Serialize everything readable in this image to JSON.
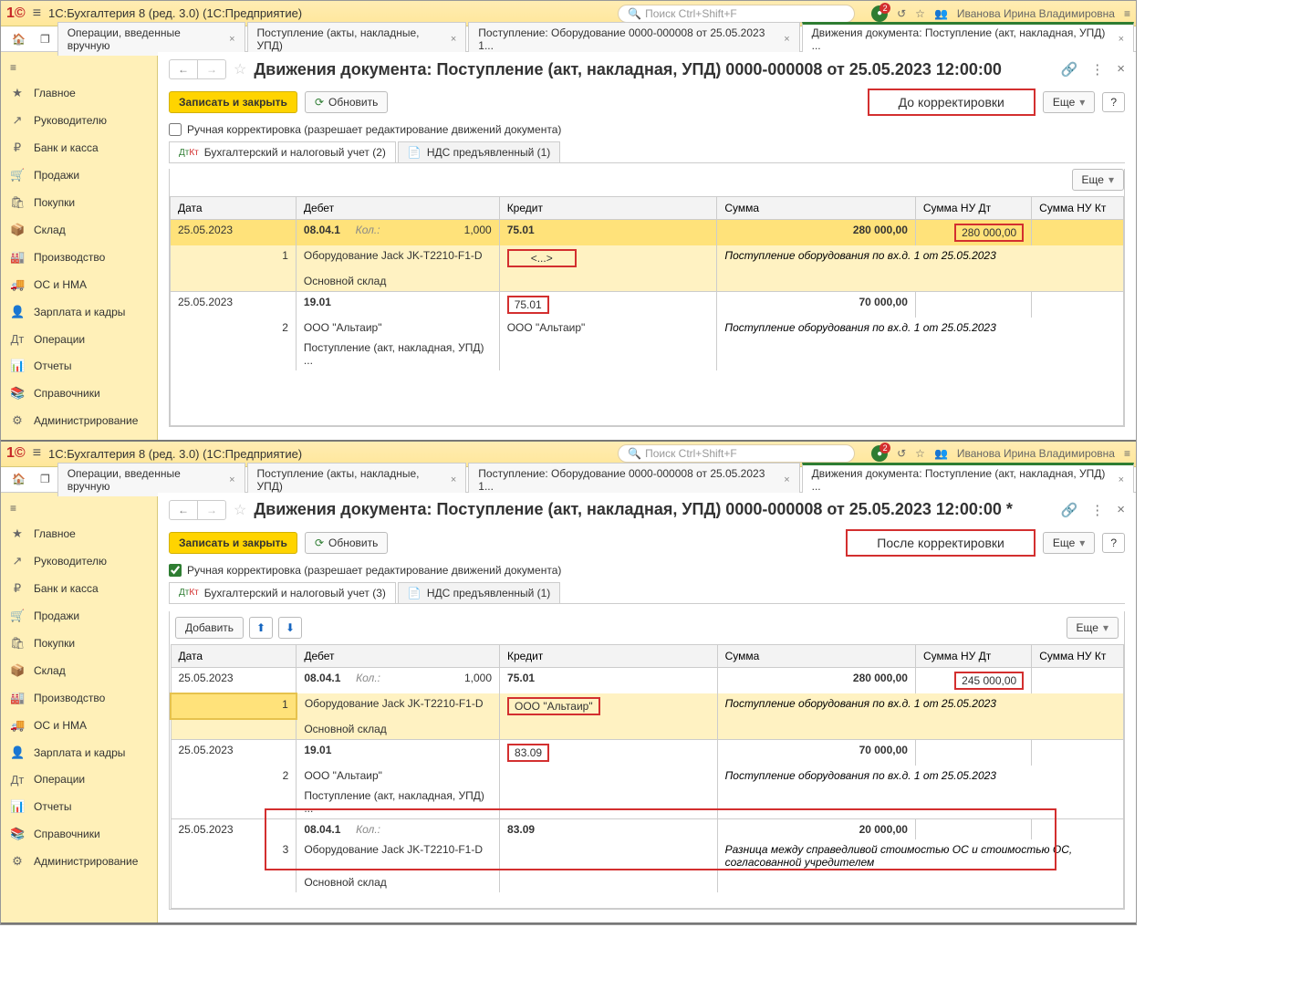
{
  "app_title": "1С:Бухгалтерия 8 (ред. 3.0)  (1С:Предприятие)",
  "search_placeholder": "Поиск Ctrl+Shift+F",
  "user_name": "Иванова Ирина Владимировна",
  "notif_badge": "2",
  "tabs": [
    "Операции, введенные вручную",
    "Поступление (акты, накладные, УПД)",
    "Поступление: Оборудование 0000-000008 от 25.05.2023 1...",
    "Движения документа: Поступление (акт, накладная, УПД) ..."
  ],
  "sidebar": [
    {
      "icon": "★",
      "label": "Главное"
    },
    {
      "icon": "↗",
      "label": "Руководителю"
    },
    {
      "icon": "₽",
      "label": "Банк и касса"
    },
    {
      "icon": "🛒",
      "label": "Продажи"
    },
    {
      "icon": "🛍",
      "label": "Покупки"
    },
    {
      "icon": "📦",
      "label": "Склад"
    },
    {
      "icon": "🏭",
      "label": "Производство"
    },
    {
      "icon": "🚚",
      "label": "ОС и НМА"
    },
    {
      "icon": "👤",
      "label": "Зарплата и кадры"
    },
    {
      "icon": "Дт",
      "label": "Операции"
    },
    {
      "icon": "📊",
      "label": "Отчеты"
    },
    {
      "icon": "📚",
      "label": "Справочники"
    },
    {
      "icon": "⚙",
      "label": "Администрирование"
    }
  ],
  "buttons": {
    "save_close": "Записать и закрыть",
    "refresh": "Обновить",
    "more": "Еще",
    "help": "?",
    "add": "Добавить"
  },
  "checkbox_label": "Ручная корректировка (разрешает редактирование движений документа)",
  "inner_tabs_before": [
    "Бухгалтерский и налоговый учет (2)",
    "НДС предъявленный (1)"
  ],
  "inner_tabs_after": [
    "Бухгалтерский и налоговый учет (3)",
    "НДС предъявленный (1)"
  ],
  "grid_headers": [
    "Дата",
    "Дебет",
    "Кредит",
    "Сумма",
    "Сумма НУ Дт",
    "Сумма НУ Кт"
  ],
  "before": {
    "title": "Движения документа: Поступление (акт, накладная, УПД) 0000-000008 от 25.05.2023 12:00:00",
    "callout": "До корректировки",
    "manual_checked": false,
    "rows": [
      {
        "date": "25.05.2023",
        "debit_acc": "08.04.1",
        "kol": "Кол.:",
        "qty": "1,000",
        "credit_acc": "75.01",
        "sum": "280 000,00",
        "nu_dt": "280 000,00",
        "nu_dt_boxed": true,
        "line_no": "1",
        "item": "Оборудование Jack JK-T2210-F1-D",
        "credit_sub": "<...>",
        "credit_sub_boxed": true,
        "comment": "Поступление оборудования по вх.д. 1 от 25.05.2023",
        "store": "Основной склад"
      },
      {
        "date": "25.05.2023",
        "debit_acc": "19.01",
        "credit_acc": "75.01",
        "credit_boxed": true,
        "sum": "70 000,00",
        "line_no": "2",
        "item": "ООО \"Альтаир\"",
        "credit_sub": "ООО \"Альтаир\"",
        "comment": "Поступление оборудования по вх.д. 1 от 25.05.2023",
        "store": "Поступление (акт, накладная, УПД) ..."
      }
    ]
  },
  "after": {
    "title": "Движения документа: Поступление (акт, накладная, УПД) 0000-000008 от 25.05.2023 12:00:00 *",
    "callout": "После корректировки",
    "manual_checked": true,
    "rows": [
      {
        "date": "25.05.2023",
        "debit_acc": "08.04.1",
        "kol": "Кол.:",
        "qty": "1,000",
        "credit_acc": "75.01",
        "sum": "280 000,00",
        "nu_dt": "245 000,00",
        "nu_dt_boxed": true,
        "line_no": "1",
        "item": "Оборудование Jack JK-T2210-F1-D",
        "credit_sub": "ООО \"Альтаир\"",
        "credit_sub_boxed": true,
        "comment": "Поступление оборудования по вх.д. 1 от 25.05.2023",
        "store": "Основной склад"
      },
      {
        "date": "25.05.2023",
        "debit_acc": "19.01",
        "credit_acc": "83.09",
        "credit_boxed": true,
        "sum": "70 000,00",
        "line_no": "2",
        "item": "ООО \"Альтаир\"",
        "comment": "Поступление оборудования по вх.д. 1 от 25.05.2023",
        "store": "Поступление (акт, накладная, УПД) ..."
      },
      {
        "date": "25.05.2023",
        "debit_acc": "08.04.1",
        "kol": "Кол.:",
        "credit_acc": "83.09",
        "sum": "20 000,00",
        "line_no": "3",
        "item": "Оборудование Jack JK-T2210-F1-D",
        "comment": "Разница между справедливой стоимостью ОС и стоимостью ОС, согласованной учредителем",
        "store": "Основной склад",
        "whole_row_boxed": true
      }
    ]
  }
}
